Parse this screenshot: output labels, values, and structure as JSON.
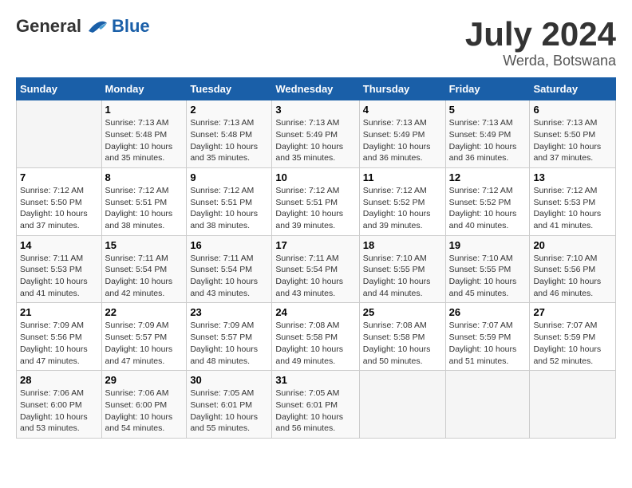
{
  "logo": {
    "general": "General",
    "blue": "Blue"
  },
  "title": {
    "month": "July 2024",
    "location": "Werda, Botswana"
  },
  "headers": [
    "Sunday",
    "Monday",
    "Tuesday",
    "Wednesday",
    "Thursday",
    "Friday",
    "Saturday"
  ],
  "weeks": [
    [
      {
        "day": "",
        "info": ""
      },
      {
        "day": "1",
        "info": "Sunrise: 7:13 AM\nSunset: 5:48 PM\nDaylight: 10 hours and 35 minutes."
      },
      {
        "day": "2",
        "info": "Sunrise: 7:13 AM\nSunset: 5:48 PM\nDaylight: 10 hours and 35 minutes."
      },
      {
        "day": "3",
        "info": "Sunrise: 7:13 AM\nSunset: 5:49 PM\nDaylight: 10 hours and 35 minutes."
      },
      {
        "day": "4",
        "info": "Sunrise: 7:13 AM\nSunset: 5:49 PM\nDaylight: 10 hours and 36 minutes."
      },
      {
        "day": "5",
        "info": "Sunrise: 7:13 AM\nSunset: 5:49 PM\nDaylight: 10 hours and 36 minutes."
      },
      {
        "day": "6",
        "info": "Sunrise: 7:13 AM\nSunset: 5:50 PM\nDaylight: 10 hours and 37 minutes."
      }
    ],
    [
      {
        "day": "7",
        "info": "Sunrise: 7:12 AM\nSunset: 5:50 PM\nDaylight: 10 hours and 37 minutes."
      },
      {
        "day": "8",
        "info": "Sunrise: 7:12 AM\nSunset: 5:51 PM\nDaylight: 10 hours and 38 minutes."
      },
      {
        "day": "9",
        "info": "Sunrise: 7:12 AM\nSunset: 5:51 PM\nDaylight: 10 hours and 38 minutes."
      },
      {
        "day": "10",
        "info": "Sunrise: 7:12 AM\nSunset: 5:51 PM\nDaylight: 10 hours and 39 minutes."
      },
      {
        "day": "11",
        "info": "Sunrise: 7:12 AM\nSunset: 5:52 PM\nDaylight: 10 hours and 39 minutes."
      },
      {
        "day": "12",
        "info": "Sunrise: 7:12 AM\nSunset: 5:52 PM\nDaylight: 10 hours and 40 minutes."
      },
      {
        "day": "13",
        "info": "Sunrise: 7:12 AM\nSunset: 5:53 PM\nDaylight: 10 hours and 41 minutes."
      }
    ],
    [
      {
        "day": "14",
        "info": "Sunrise: 7:11 AM\nSunset: 5:53 PM\nDaylight: 10 hours and 41 minutes."
      },
      {
        "day": "15",
        "info": "Sunrise: 7:11 AM\nSunset: 5:54 PM\nDaylight: 10 hours and 42 minutes."
      },
      {
        "day": "16",
        "info": "Sunrise: 7:11 AM\nSunset: 5:54 PM\nDaylight: 10 hours and 43 minutes."
      },
      {
        "day": "17",
        "info": "Sunrise: 7:11 AM\nSunset: 5:54 PM\nDaylight: 10 hours and 43 minutes."
      },
      {
        "day": "18",
        "info": "Sunrise: 7:10 AM\nSunset: 5:55 PM\nDaylight: 10 hours and 44 minutes."
      },
      {
        "day": "19",
        "info": "Sunrise: 7:10 AM\nSunset: 5:55 PM\nDaylight: 10 hours and 45 minutes."
      },
      {
        "day": "20",
        "info": "Sunrise: 7:10 AM\nSunset: 5:56 PM\nDaylight: 10 hours and 46 minutes."
      }
    ],
    [
      {
        "day": "21",
        "info": "Sunrise: 7:09 AM\nSunset: 5:56 PM\nDaylight: 10 hours and 47 minutes."
      },
      {
        "day": "22",
        "info": "Sunrise: 7:09 AM\nSunset: 5:57 PM\nDaylight: 10 hours and 47 minutes."
      },
      {
        "day": "23",
        "info": "Sunrise: 7:09 AM\nSunset: 5:57 PM\nDaylight: 10 hours and 48 minutes."
      },
      {
        "day": "24",
        "info": "Sunrise: 7:08 AM\nSunset: 5:58 PM\nDaylight: 10 hours and 49 minutes."
      },
      {
        "day": "25",
        "info": "Sunrise: 7:08 AM\nSunset: 5:58 PM\nDaylight: 10 hours and 50 minutes."
      },
      {
        "day": "26",
        "info": "Sunrise: 7:07 AM\nSunset: 5:59 PM\nDaylight: 10 hours and 51 minutes."
      },
      {
        "day": "27",
        "info": "Sunrise: 7:07 AM\nSunset: 5:59 PM\nDaylight: 10 hours and 52 minutes."
      }
    ],
    [
      {
        "day": "28",
        "info": "Sunrise: 7:06 AM\nSunset: 6:00 PM\nDaylight: 10 hours and 53 minutes."
      },
      {
        "day": "29",
        "info": "Sunrise: 7:06 AM\nSunset: 6:00 PM\nDaylight: 10 hours and 54 minutes."
      },
      {
        "day": "30",
        "info": "Sunrise: 7:05 AM\nSunset: 6:01 PM\nDaylight: 10 hours and 55 minutes."
      },
      {
        "day": "31",
        "info": "Sunrise: 7:05 AM\nSunset: 6:01 PM\nDaylight: 10 hours and 56 minutes."
      },
      {
        "day": "",
        "info": ""
      },
      {
        "day": "",
        "info": ""
      },
      {
        "day": "",
        "info": ""
      }
    ]
  ]
}
